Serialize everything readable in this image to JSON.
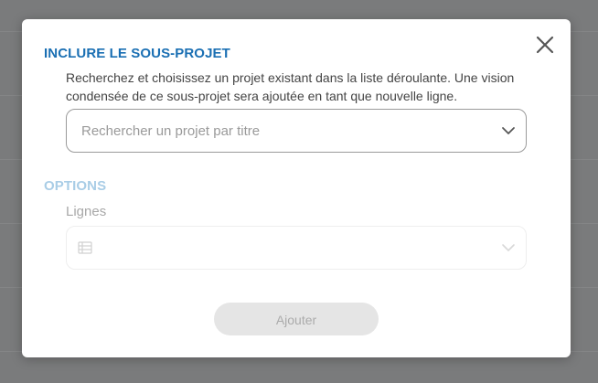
{
  "modal": {
    "title": "INCLURE LE SOUS-PROJET",
    "description": "Recherchez et choisissez un projet existant dans la liste déroulante. Une vision condensée de ce sous-projet sera ajoutée en tant que nouvelle ligne.",
    "project_select": {
      "placeholder": "Rechercher un projet par titre",
      "icon": "chevron-down-icon"
    },
    "options": {
      "title": "OPTIONS",
      "lines_label": "Lignes",
      "lines_select": {
        "value": "",
        "icon": "table-icon"
      }
    },
    "add_button_label": "Ajouter",
    "close_icon": "close-icon"
  },
  "colors": {
    "title_blue": "#1a6fb3",
    "options_title_light_blue": "#a9cde6",
    "overlay": "#7a7b7c",
    "disabled_button_bg": "#e5e5e5"
  }
}
